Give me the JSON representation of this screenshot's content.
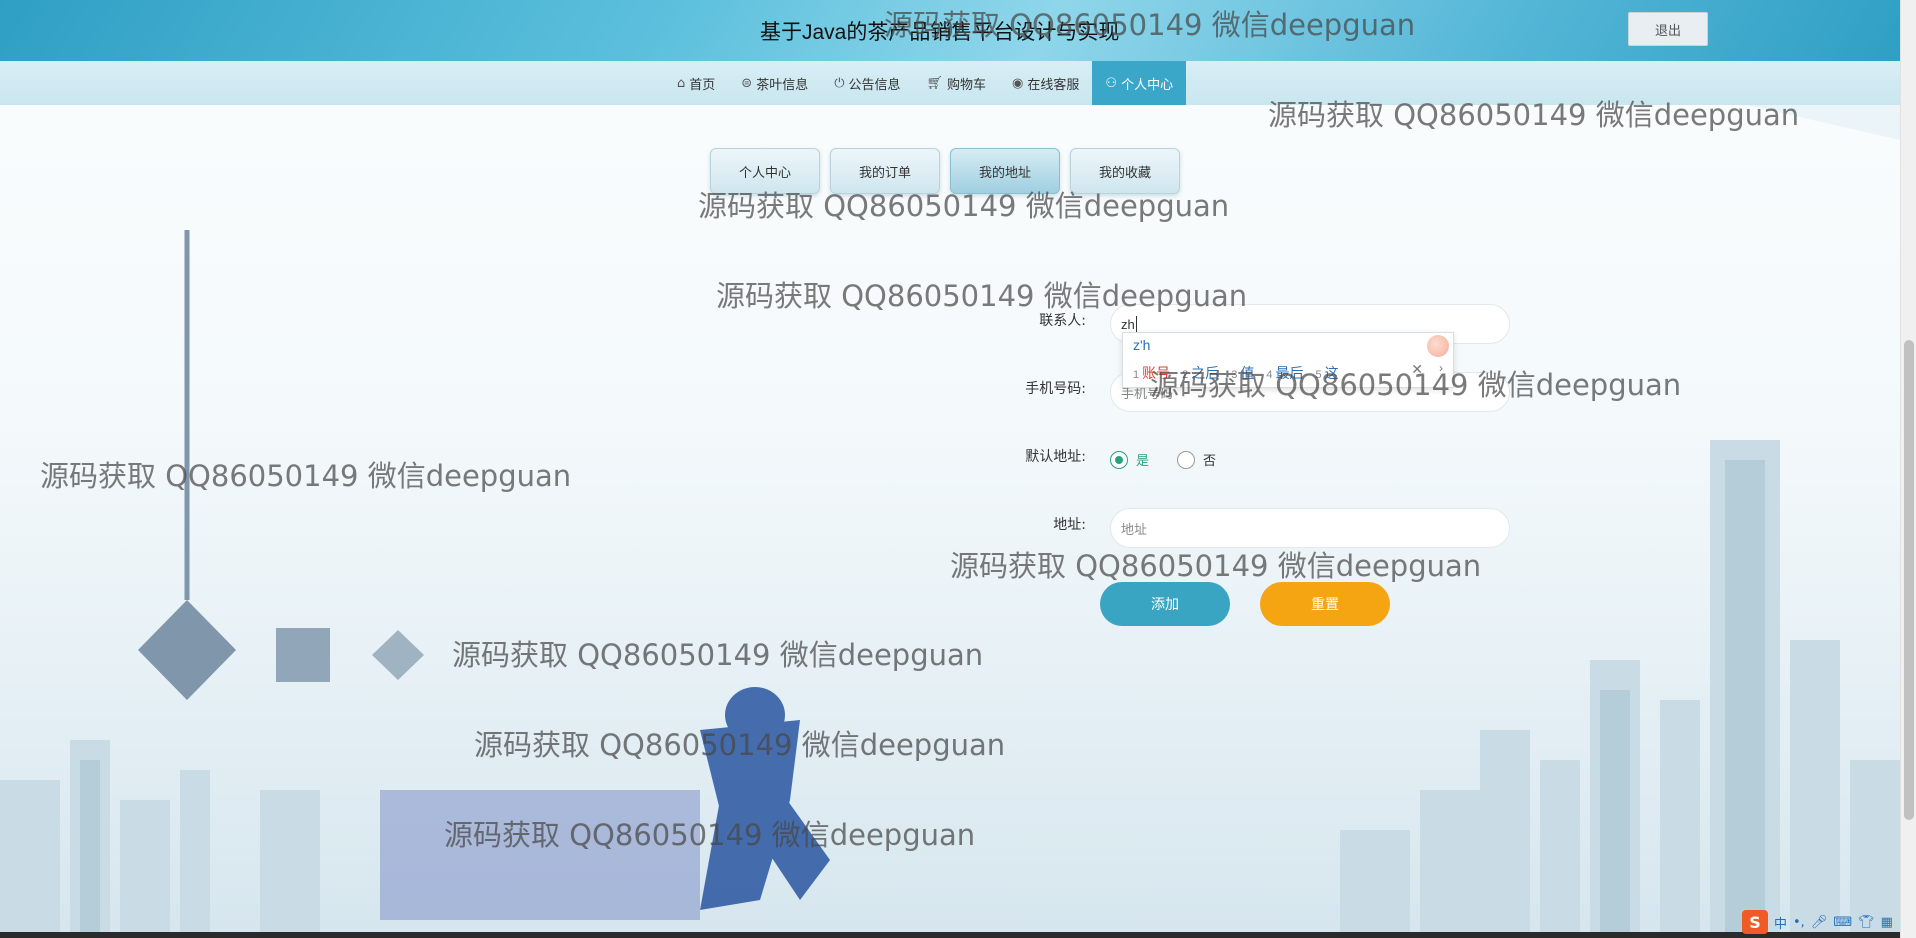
{
  "header": {
    "title": "基于Java的茶产品销售平台设计与实现",
    "logout_label": "退出"
  },
  "nav": {
    "items": [
      {
        "label": "首页",
        "icon": "home-icon"
      },
      {
        "label": "茶叶信息",
        "icon": "tea-icon"
      },
      {
        "label": "公告信息",
        "icon": "power-icon"
      },
      {
        "label": "购物车",
        "icon": "cart-icon"
      },
      {
        "label": "在线客服",
        "icon": "chat-icon"
      },
      {
        "label": "个人中心",
        "icon": "user-icon",
        "active": true
      }
    ]
  },
  "tabs": [
    {
      "label": "个人中心"
    },
    {
      "label": "我的订单"
    },
    {
      "label": "我的地址",
      "active": true
    },
    {
      "label": "我的收藏"
    }
  ],
  "form": {
    "contact_label": "联系人:",
    "contact_value": "zh",
    "phone_label": "手机号码:",
    "phone_placeholder": "手机号码",
    "default_label": "默认地址:",
    "default_yes": "是",
    "default_no": "否",
    "default_selected": "是",
    "address_label": "地址:",
    "address_placeholder": "地址",
    "add_button": "添加",
    "reset_button": "重置"
  },
  "ime": {
    "composition": "z'h",
    "candidates": [
      {
        "num": "1",
        "text": "账号"
      },
      {
        "num": "2",
        "text": "之后"
      },
      {
        "num": "3",
        "text": "值"
      },
      {
        "num": "4",
        "text": "最后"
      },
      {
        "num": "5",
        "text": "这"
      }
    ],
    "close": "✕",
    "more": "›"
  },
  "watermark": {
    "text": "源码获取 QQ86050149 微信deepguan"
  },
  "tray": {
    "logo": "S",
    "mode": "中",
    "punct": "•,",
    "mic_icon": "mic-icon",
    "keyboard_icon": "keyboard-icon",
    "shirt_icon": "shirt-icon",
    "grid_icon": "grid-icon"
  },
  "colors": {
    "accent": "#3aa7c9",
    "add_button": "#3aa4c3",
    "reset_button": "#f5a412",
    "radio_checked": "#2aa27a"
  }
}
